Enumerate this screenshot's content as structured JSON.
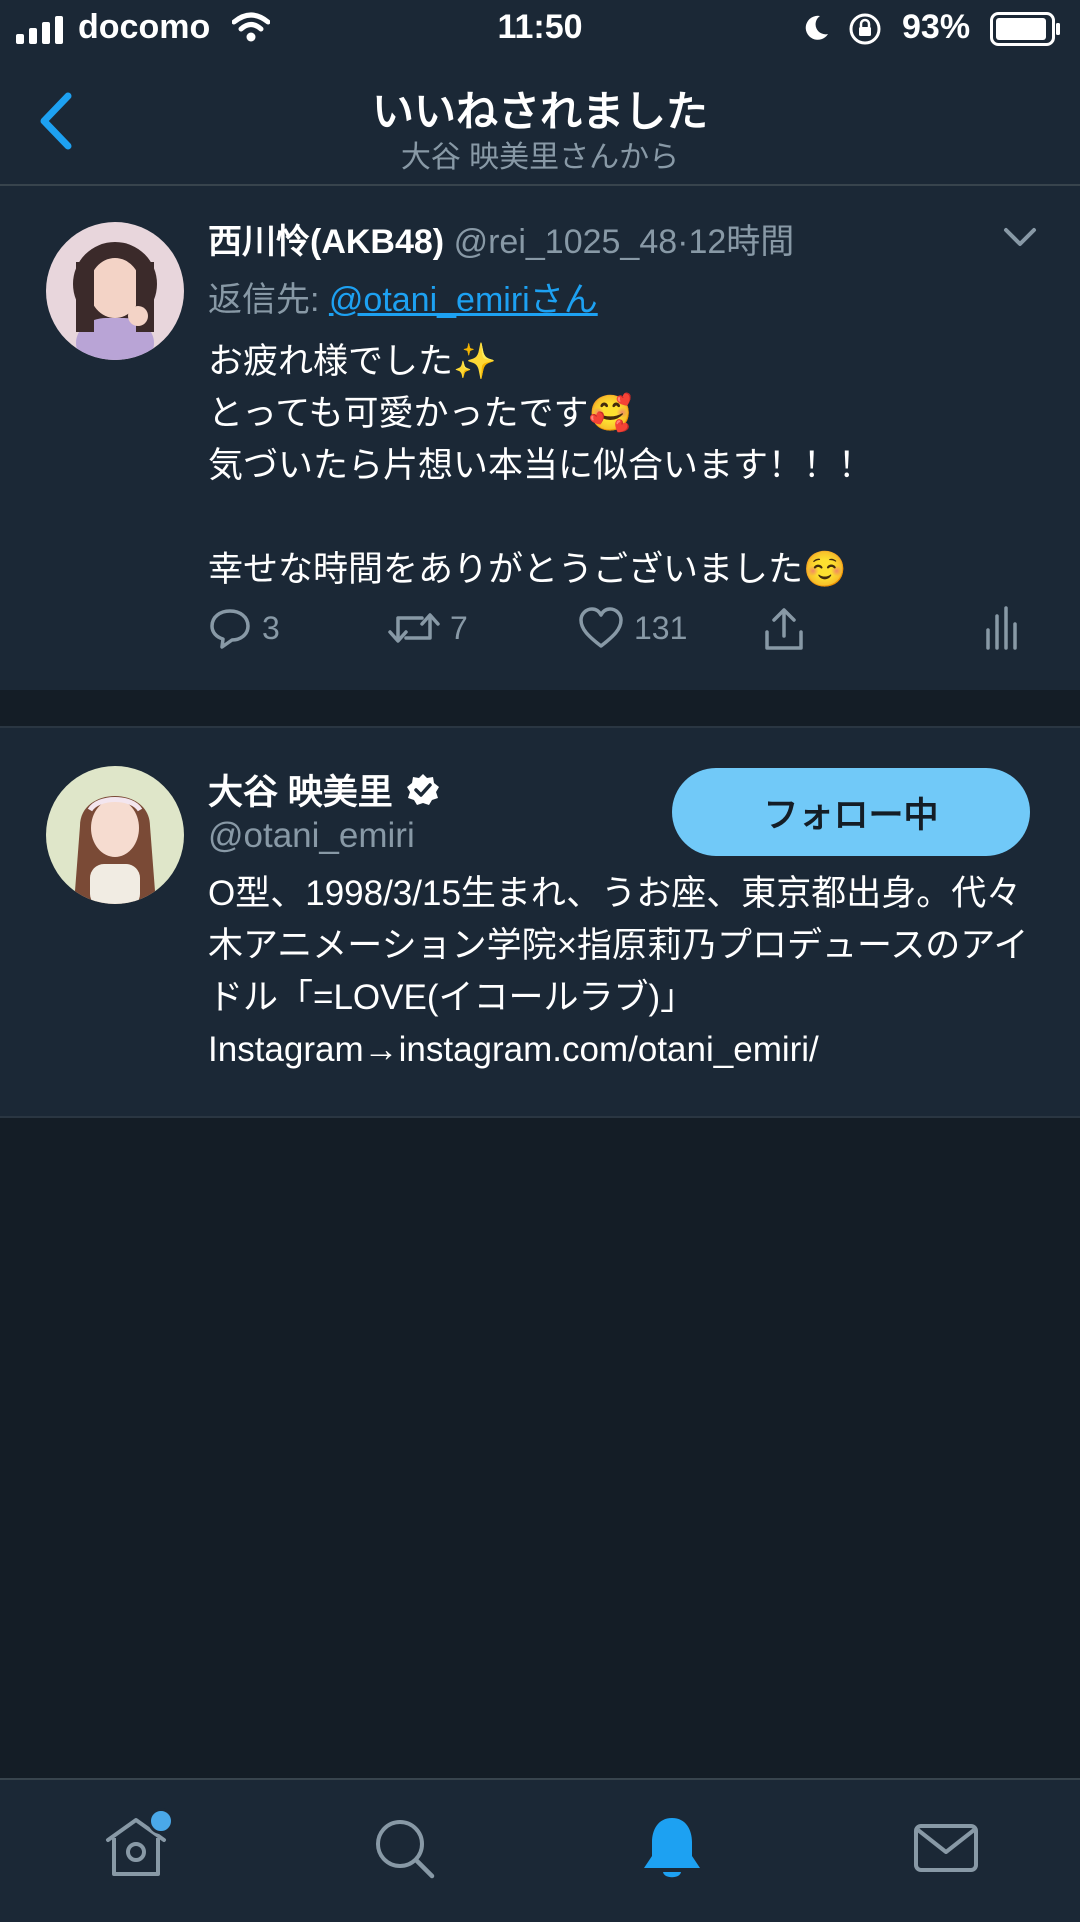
{
  "status_bar": {
    "carrier": "docomo",
    "time": "11:50",
    "battery_percent": "93%"
  },
  "nav": {
    "title": "いいねされました",
    "subtitle": "大谷 映美里さんから"
  },
  "tweet": {
    "author_name": "西川怜(AKB48)",
    "author_handle": "@rei_1025_48",
    "separator": "·",
    "time_ago": "12時間",
    "reply_prefix": "返信先: ",
    "reply_to": "@otani_emiriさん",
    "text": "お疲れ様でした✨\nとっても可愛かったです🥰\n気づいたら片想い本当に似合います！！！\n\n幸せな時間をありがとうございました☺️",
    "reply_count": "3",
    "retweet_count": "7",
    "like_count": "131"
  },
  "user": {
    "name": "大谷 映美里",
    "handle": "@otani_emiri",
    "follow_label": "フォロー中",
    "bio": "O型、1998/3/15生まれ、うお座、東京都出身。代々木アニメーション学院×指原莉乃プロデュースのアイドル「=LOVE(イコールラブ)」Instagram→instagram.com/otani_emiri/"
  },
  "colors": {
    "background": "#141d26",
    "card": "#1b2836",
    "accent": "#1da1f2",
    "follow_button": "#71c9f8",
    "secondary_text": "#8899a6"
  },
  "icons": {
    "back": "chevron-left-icon",
    "more": "chevron-down-icon",
    "reply": "reply-icon",
    "retweet": "retweet-icon",
    "like": "heart-icon",
    "share": "share-icon",
    "stats": "analytics-icon",
    "verified": "verified-badge-icon",
    "home": "home-icon",
    "search": "search-icon",
    "notifications": "bell-icon",
    "messages": "mail-icon"
  }
}
